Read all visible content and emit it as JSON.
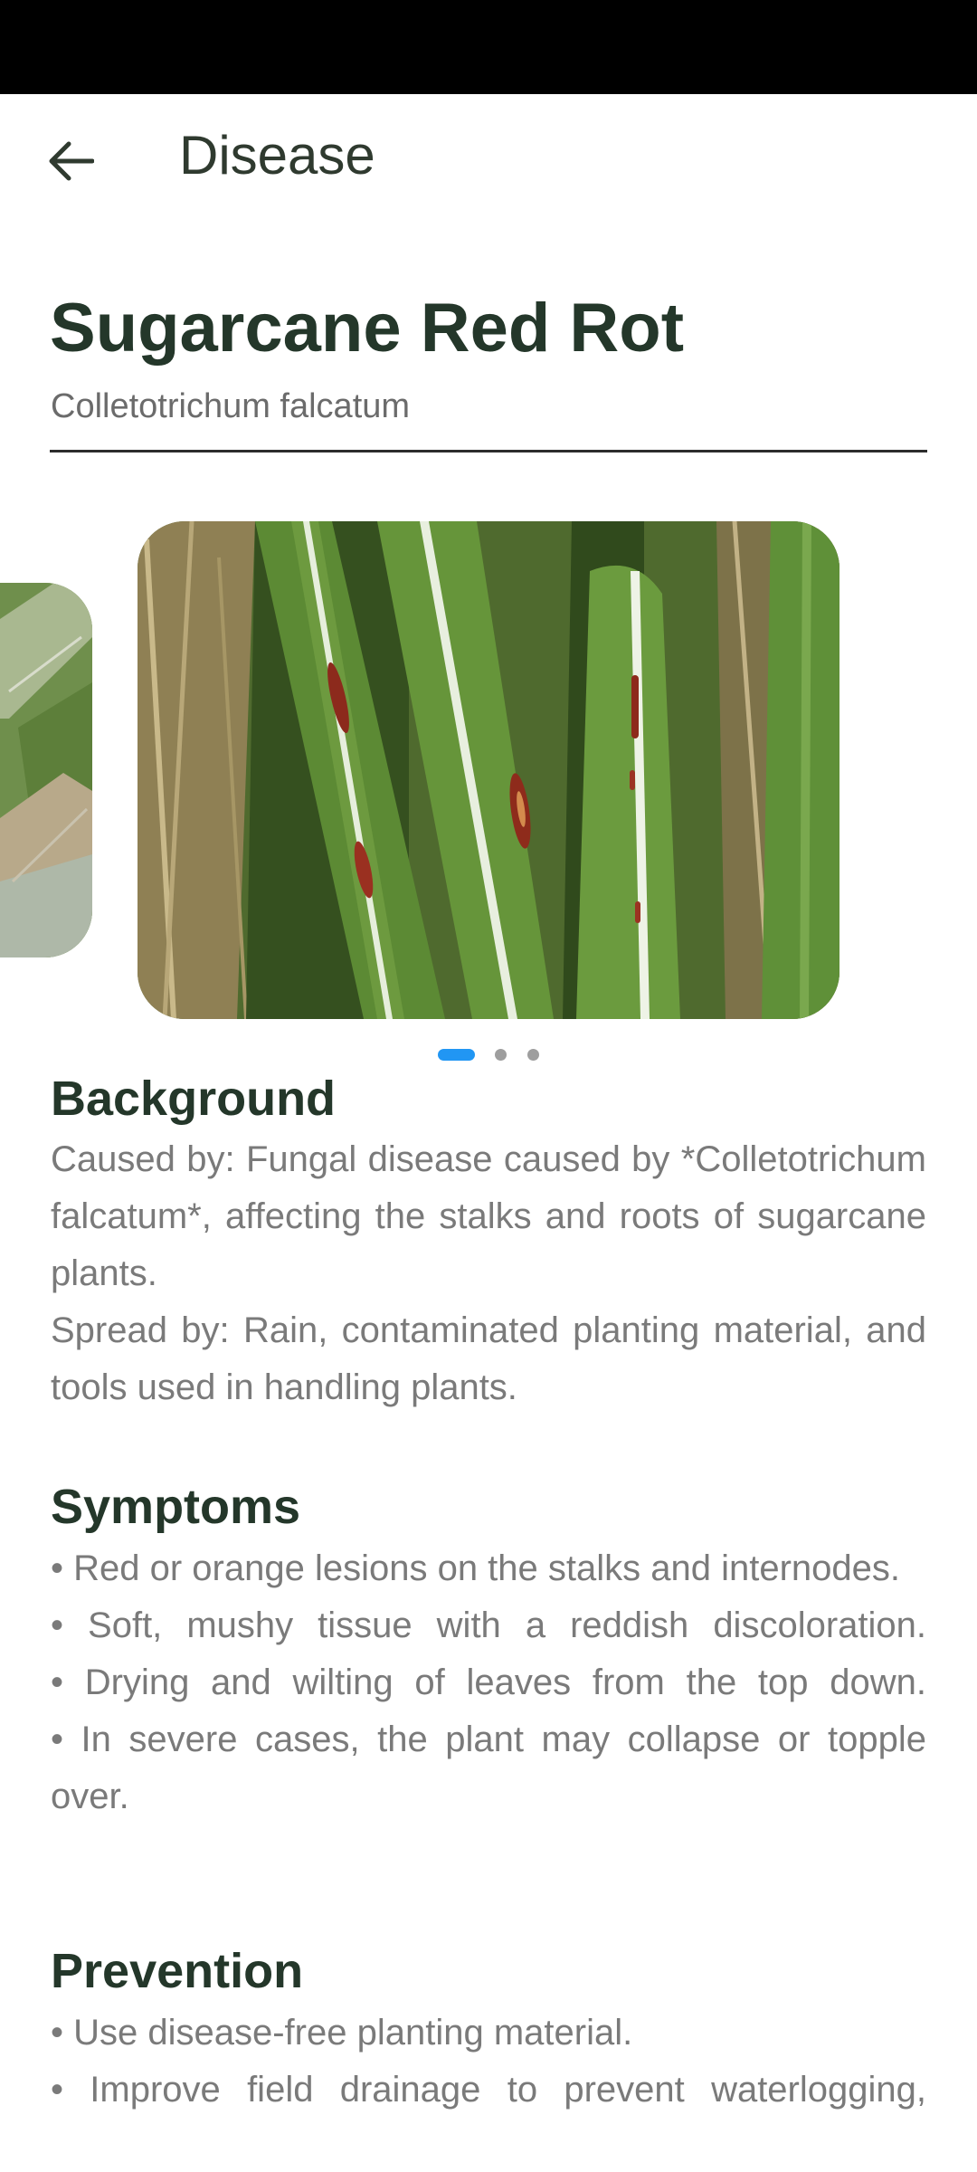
{
  "app_bar": {
    "back_icon": "arrow-left-icon",
    "title": "Disease"
  },
  "disease": {
    "name": "Sugarcane Red Rot",
    "scientific_name": "Colletotrichum falcatum"
  },
  "carousel": {
    "image_count": 3,
    "active_index": 0,
    "images": [
      "sugarcane-leaves-with-red-rot-lesions",
      "sugarcane-leaf-close-up"
    ]
  },
  "colors": {
    "heading": "#24372a",
    "body_text": "#7a7a7a",
    "accent_dot": "#2196f3",
    "inactive_dot": "#9e9e9e",
    "status_bar": "#000000"
  },
  "sections": {
    "background": {
      "heading": "Background",
      "lines": [
        "Caused by: Fungal disease caused by *Colletotrichum falcatum*, affecting the stalks and roots of sugarcane plants.",
        "Spread by: Rain, contaminated planting material, and tools used in handling plants."
      ]
    },
    "symptoms": {
      "heading": "Symptoms",
      "lines": [
        "• Red or orange lesions on the stalks and internodes.",
        "• Soft, mushy tissue with a reddish discoloration.",
        "• Drying and wilting of leaves from the top down.",
        "• In severe cases, the plant may collapse or topple over."
      ]
    },
    "prevention": {
      "heading": "Prevention",
      "lines": [
        "• Use disease-free planting material.",
        "• Improve field drainage to prevent waterlogging,"
      ]
    }
  }
}
